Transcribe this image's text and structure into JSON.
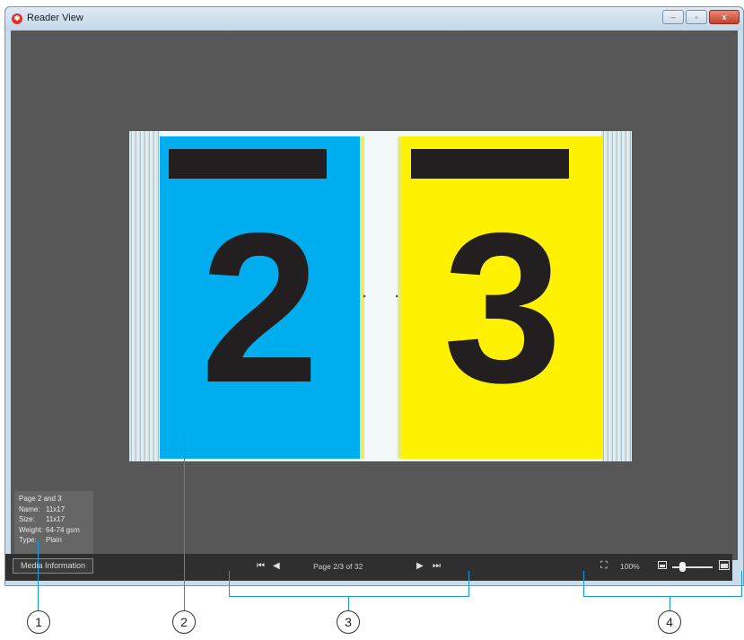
{
  "window": {
    "app_icon": "reader-app-icon",
    "title": "Reader View",
    "controls": {
      "minimize": "–",
      "restore": "▫",
      "close": "x"
    }
  },
  "spread": {
    "left_page": {
      "number": "2",
      "color": "#00aeef"
    },
    "right_page": {
      "number": "3",
      "color": "#fff200"
    }
  },
  "media_info": {
    "heading": "Page 2 and 3",
    "rows": [
      {
        "key": "Name:",
        "value": "11x17"
      },
      {
        "key": "Size:",
        "value": "11x17"
      },
      {
        "key": "Weight:",
        "value": "64-74 gsm"
      },
      {
        "key": "Type:",
        "value": "Plain"
      }
    ]
  },
  "toolbar": {
    "media_button": "Media Information",
    "first_page_icon": "first-page-icon",
    "prev_page_icon": "previous-page-icon",
    "page_label": "Page 2/3 of 32",
    "next_page_icon": "next-page-icon",
    "last_page_icon": "last-page-icon",
    "fit_icon": "fit-to-window-icon",
    "zoom_label": "100%",
    "zoom_level": 0.25
  },
  "callouts": [
    "1",
    "2",
    "3",
    "4"
  ]
}
